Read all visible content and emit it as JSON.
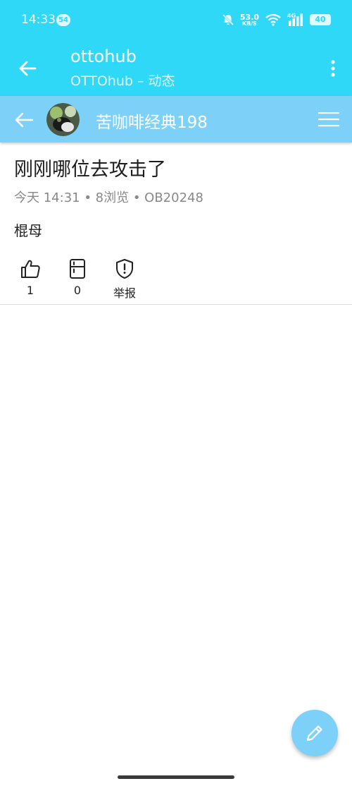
{
  "status_bar": {
    "time": "14:33",
    "notification_count": "54",
    "net_speed_value": "53.0",
    "net_speed_unit": "KB/S",
    "network_type": "4G",
    "battery": "40",
    "icons": [
      "mute-bell-icon",
      "wifi-icon",
      "signal-icon",
      "battery-icon"
    ]
  },
  "app_bar": {
    "title": "ottohub",
    "subtitle": "OTTOhub – 动态",
    "back_icon": "arrow-left-icon",
    "menu_icon": "more-vert-icon"
  },
  "inner_header": {
    "username": "苦咖啡经典198",
    "back_icon": "arrow-left-icon",
    "menu_icon": "hamburger-menu-icon"
  },
  "post": {
    "title": "刚刚哪位去攻击了",
    "meta": "今天 14:31 • 8浏览 • OB20248",
    "body": "棍母",
    "actions": {
      "like_count": "1",
      "favorite_count": "0",
      "report_label": "举报"
    }
  },
  "fab": {
    "icon": "pencil-icon"
  },
  "colors": {
    "primary": "#2fd8f6",
    "secondary": "#7dd0f7",
    "meta_text": "#888888"
  }
}
